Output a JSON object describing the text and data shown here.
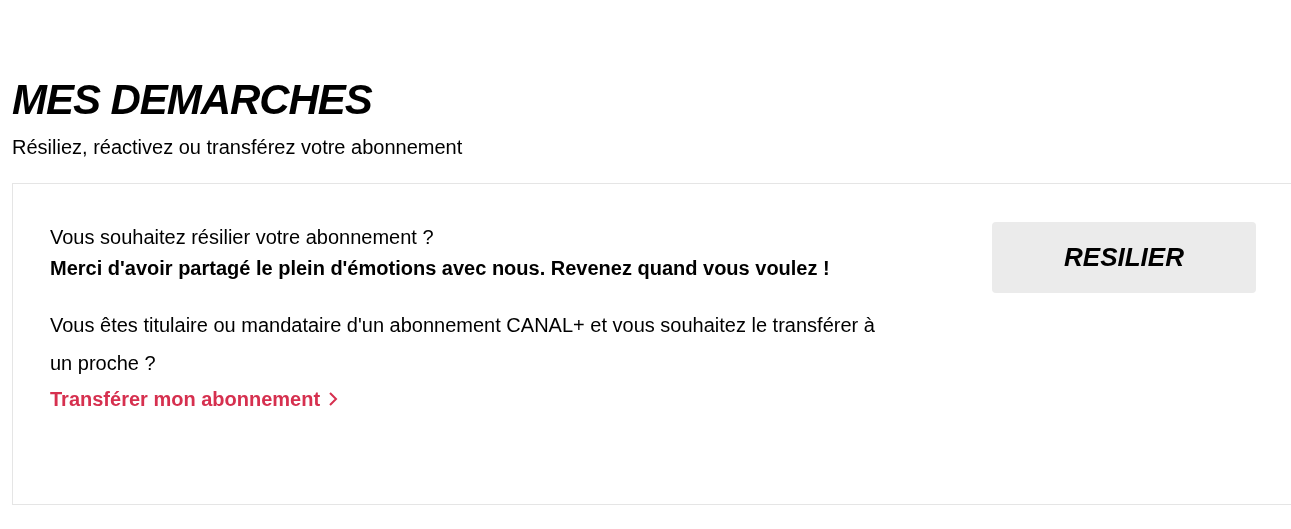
{
  "title": "MES DEMARCHES",
  "subtitle": "Résiliez, réactivez ou transférez votre abonnement",
  "card": {
    "question": "Vous souhaitez résilier votre abonnement ?",
    "message": "Merci d'avoir partagé le plein d'émotions avec nous. Revenez quand vous voulez !",
    "transfer_text": "Vous êtes titulaire ou mandataire d'un abonnement CANAL+ et vous souhaitez le transférer à un proche ?",
    "transfer_link": "Transférer mon abonnement",
    "button": "RESILIER"
  }
}
